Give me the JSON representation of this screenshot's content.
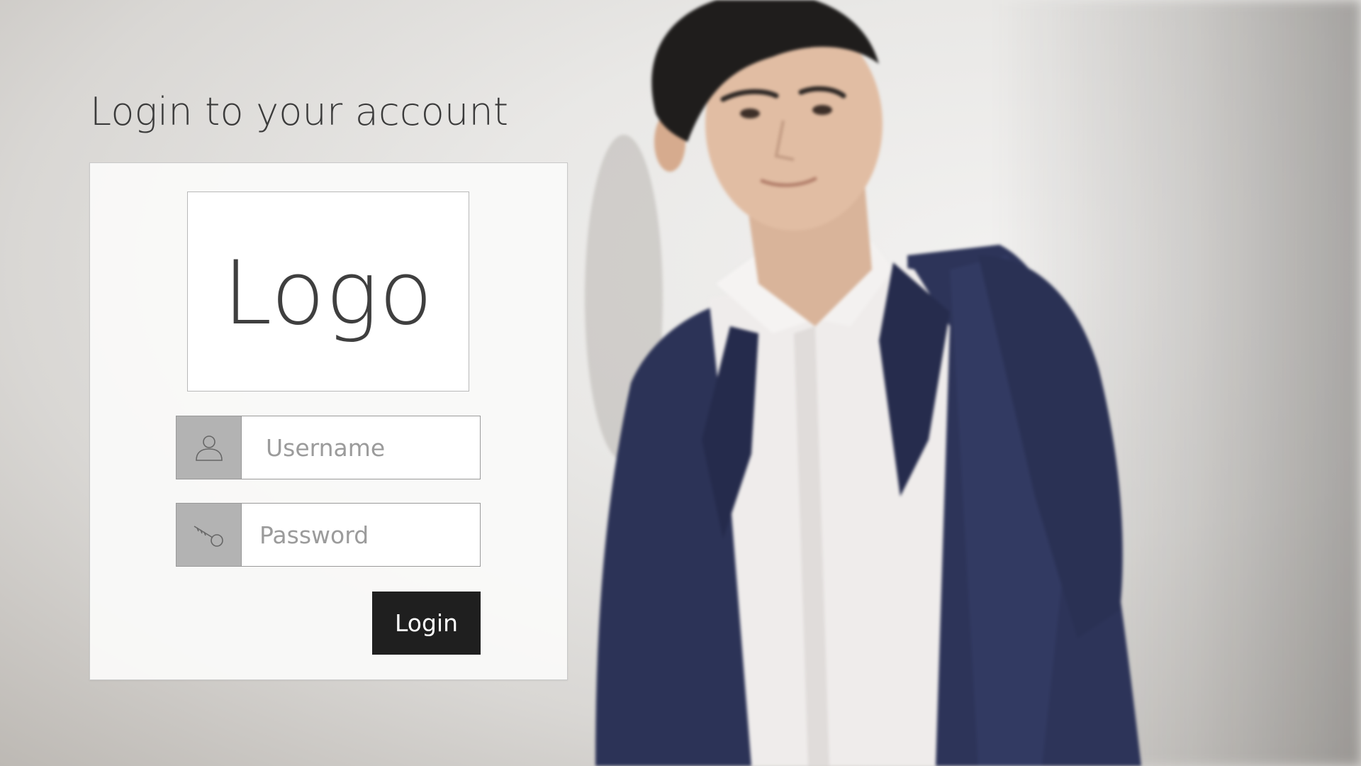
{
  "page": {
    "title": "Login to your account"
  },
  "logo": {
    "text": "Logo"
  },
  "form": {
    "username": {
      "placeholder": "Username",
      "value": "",
      "icon": "user-icon"
    },
    "password": {
      "placeholder": "Password",
      "value": "",
      "icon": "key-icon"
    },
    "login_button_label": "Login"
  },
  "colors": {
    "button_background": "#1f1f1f",
    "icon_box_background": "#b3b3b3",
    "title_text": "#3b3b3b"
  },
  "background": {
    "image": "person-in-navy-suit-photo"
  }
}
